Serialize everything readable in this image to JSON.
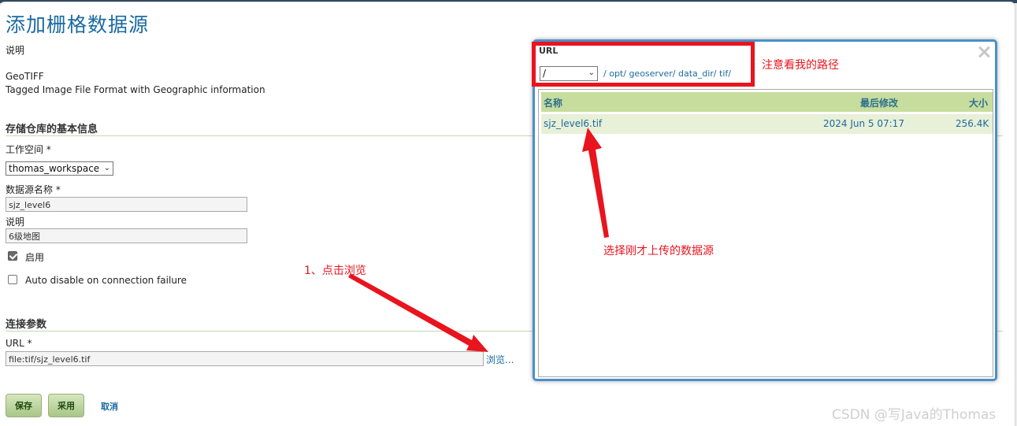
{
  "page": {
    "title": "添加栅格数据源",
    "description_label": "说明",
    "format_name": "GeoTIFF",
    "format_desc": "Tagged Image File Format with Geographic information"
  },
  "basic_info": {
    "heading": "存储仓库的基本信息",
    "workspace_label": "工作空间 *",
    "workspace_value": "thomas_workspace",
    "datasource_label": "数据源名称 *",
    "datasource_value": "sjz_level6",
    "description_label": "说明",
    "description_value": "6级地图",
    "enabled_label": "启用",
    "enabled_checked": true,
    "auto_disable_label": "Auto disable on connection failure",
    "auto_disable_checked": false
  },
  "connection": {
    "heading": "连接参数",
    "url_label": "URL *",
    "url_value": "file:tif/sjz_level6.tif",
    "browse_label": "浏览..."
  },
  "buttons": {
    "save": "保存",
    "apply": "采用",
    "cancel": "取消"
  },
  "dialog": {
    "title": "URL",
    "root_select": "/",
    "path_links": [
      "/",
      "opt/",
      "geoserver/",
      "data_dir/",
      "tif/"
    ],
    "columns": {
      "name": "名称",
      "modified": "最后修改",
      "size": "大小"
    },
    "files": [
      {
        "name": "sjz_level6.tif",
        "modified": "2024 Jun 5 07:17",
        "size": "256.4K"
      }
    ]
  },
  "annotations": {
    "path_note": "注意看我的路径",
    "select_note": "选择刚才上传的数据源",
    "browse_note": "1、点击浏览",
    "color": "#e8141e"
  },
  "watermark": "CSDN @写Java的Thomas"
}
